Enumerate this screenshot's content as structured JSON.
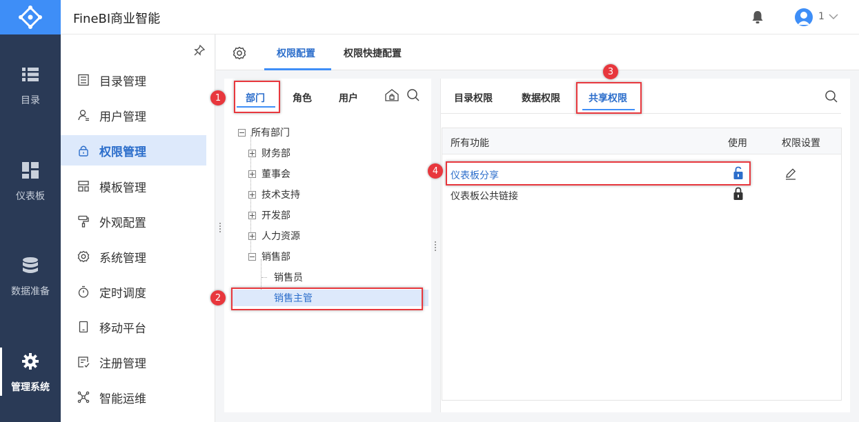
{
  "app_title": "FineBI商业智能",
  "user": {
    "name": "1"
  },
  "rail": [
    {
      "label": "目录",
      "icon": "list-icon"
    },
    {
      "label": "仪表板",
      "icon": "dashboard-icon"
    },
    {
      "label": "数据准备",
      "icon": "database-icon"
    },
    {
      "label": "管理系统",
      "icon": "gear-icon",
      "active": true
    }
  ],
  "menu": [
    {
      "label": "目录管理",
      "icon": "catalog-icon"
    },
    {
      "label": "用户管理",
      "icon": "user-icon"
    },
    {
      "label": "权限管理",
      "icon": "lock-icon",
      "active": true
    },
    {
      "label": "模板管理",
      "icon": "template-icon"
    },
    {
      "label": "外观配置",
      "icon": "paint-roller-icon"
    },
    {
      "label": "系统管理",
      "icon": "settings-icon"
    },
    {
      "label": "定时调度",
      "icon": "timer-icon"
    },
    {
      "label": "移动平台",
      "icon": "mobile-icon"
    },
    {
      "label": "注册管理",
      "icon": "register-icon"
    },
    {
      "label": "智能运维",
      "icon": "network-icon"
    }
  ],
  "top_tabs": [
    {
      "label": "权限配置",
      "active": true
    },
    {
      "label": "权限快捷配置"
    }
  ],
  "tree_tabs": [
    {
      "label": "部门",
      "active": true
    },
    {
      "label": "角色"
    },
    {
      "label": "用户"
    }
  ],
  "tree": {
    "root": "所有部门",
    "children": [
      "财务部",
      "董事会",
      "技术支持",
      "开发部",
      "人力资源",
      "销售部"
    ],
    "sales_children": [
      "销售员",
      "销售主管"
    ]
  },
  "perm_tabs": [
    {
      "label": "目录权限"
    },
    {
      "label": "数据权限"
    },
    {
      "label": "共享权限",
      "active": true
    }
  ],
  "table": {
    "headers": [
      "所有功能",
      "使用",
      "权限设置"
    ],
    "rows": [
      {
        "name": "仪表板分享",
        "lock": "unlocked"
      },
      {
        "name": "仪表板公共链接",
        "lock": "locked"
      }
    ]
  },
  "annotations": [
    "1",
    "2",
    "3",
    "4"
  ],
  "colors": {
    "accent": "#3e8ef7",
    "annotation": "#e8373d",
    "rail": "#2a3a56"
  }
}
